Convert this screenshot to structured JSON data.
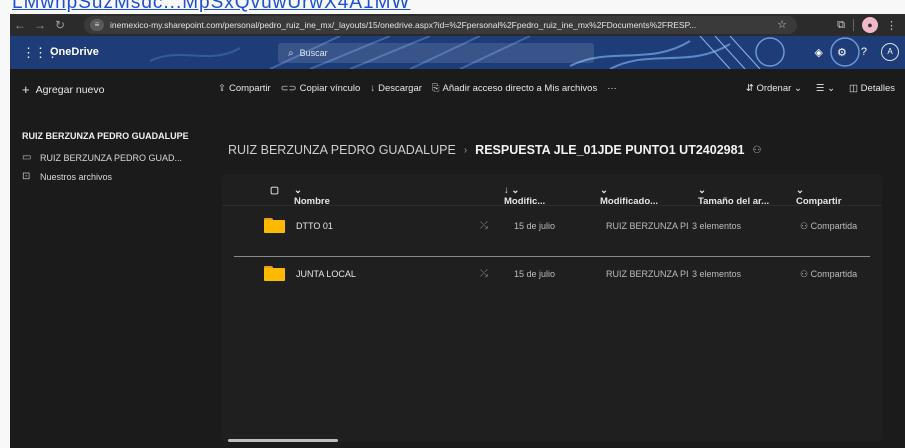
{
  "top_link": "LMwhpSuzMsdc...MpSxQvuwUrwX4A1MW",
  "browser": {
    "url": "inemexico-my.sharepoint.com/personal/pedro_ruiz_ine_mx/_layouts/15/onedrive.aspx?id=%2Fpersonal%2Fpedro_ruiz_ine_mx%2FDocuments%2FRESP...",
    "profile_initial": "•"
  },
  "header": {
    "brand": "OneDrive",
    "search_placeholder": "Buscar",
    "avatar": "A"
  },
  "commandbar": {
    "add_new": "Agregar nuevo",
    "share": "Compartir",
    "copy_link": "Copiar vínculo",
    "download": "Descargar",
    "add_shortcut": "Añadir acceso directo a Mis archivos",
    "more": "···",
    "sort": "Ordenar",
    "view": "☰",
    "details": "Detalles"
  },
  "sidebar": {
    "heading": "RUIZ BERZUNZA PEDRO GUADALUPE",
    "items": [
      {
        "label": "RUIZ BERZUNZA PEDRO GUAD..."
      },
      {
        "label": "Nuestros archivos"
      }
    ]
  },
  "breadcrumb": {
    "parent": "RUIZ BERZUNZA PEDRO GUADALUPE",
    "current": "RESPUESTA JLE_01JDE PUNTO1 UT2402981"
  },
  "table": {
    "columns": {
      "name": "Nombre",
      "modified": "Modific...",
      "modified_by": "Modificado...",
      "size": "Tamaño del ar...",
      "share": "Compartir"
    },
    "rows": [
      {
        "name": "DTTO 01",
        "modified": "15 de julio",
        "modified_by": "RUIZ BERZUNZA PI",
        "size": "3 elementos",
        "share": "Compartida"
      },
      {
        "name": "JUNTA LOCAL",
        "modified": "15 de julio",
        "modified_by": "RUIZ BERZUNZA PI",
        "size": "3 elementos",
        "share": "Compartida"
      }
    ]
  },
  "colors": {
    "header_bg": "#1f3f7a",
    "folder": "#ffb900",
    "page_bg": "#1b1b1b"
  }
}
